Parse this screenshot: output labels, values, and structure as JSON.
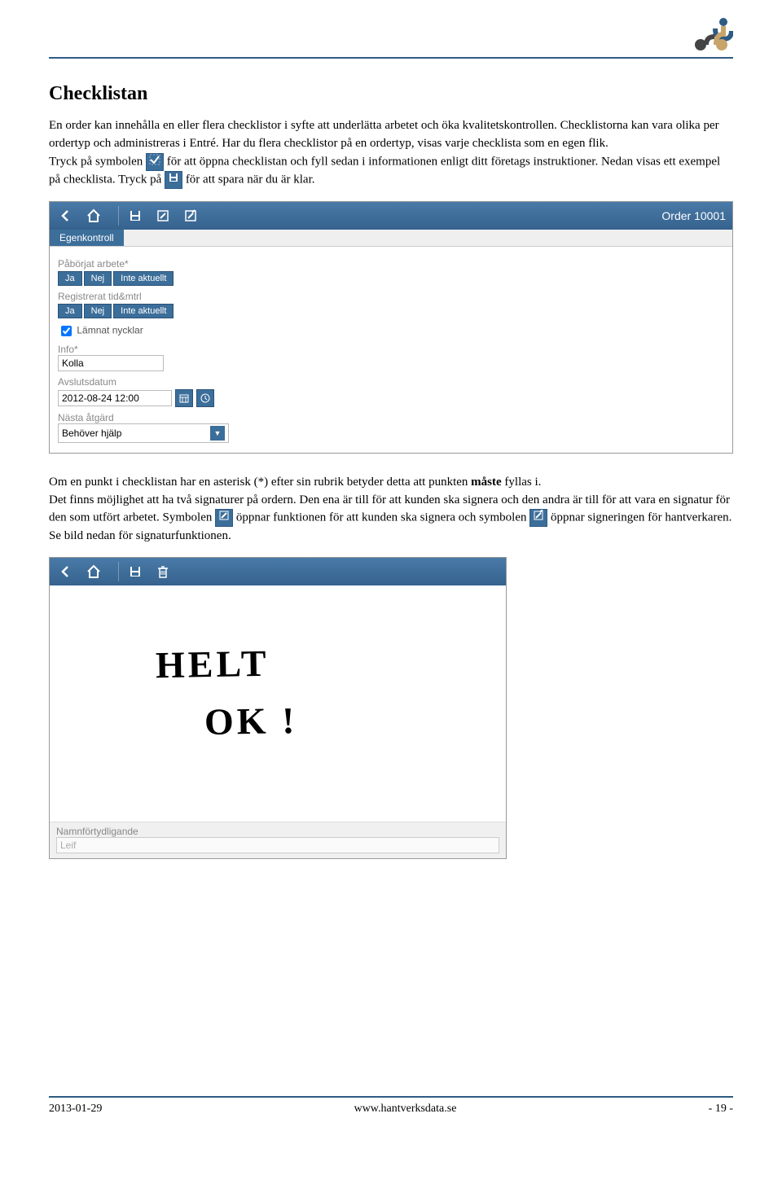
{
  "heading": "Checklistan",
  "para1_a": "En order kan innehålla en eller flera checklistor i syfte att underlätta arbetet och öka kvalitetskontrollen. Checklistorna kan vara olika per ordertyp och administreras i Entré. Har du flera checklistor på en ordertyp, visas varje checklista som en egen flik.",
  "para1_b": "Tryck på symbolen ",
  "para1_c": " för att öppna checklistan och fyll sedan i informationen enligt ditt företags instruktioner. Nedan visas ett exempel på checklista. Tryck på ",
  "para1_d": " för att spara när du är klar.",
  "screenshot1": {
    "order_label": "Order 10001",
    "tab": "Egenkontroll",
    "field1_label": "Påbörjat arbete*",
    "field2_label": "Registrerat tid&mtrl",
    "btn_yes": "Ja",
    "btn_no": "Nej",
    "btn_na": "Inte aktuellt",
    "check_label": "Lämnat nycklar",
    "info_label": "Info*",
    "info_value": "Kolla",
    "date_label": "Avslutsdatum",
    "date_value": "2012-08-24 12:00",
    "next_label": "Nästa åtgärd",
    "next_value": "Behöver hjälp"
  },
  "para2_a": "Om en punkt i checklistan har en asterisk (*) efter sin rubrik betyder detta att punkten ",
  "para2_b": "måste",
  "para2_c": " fyllas i.",
  "para3_a": "Det finns möjlighet att ha två signaturer på ordern. Den ena är till för att kunden ska signera och den andra är till för att vara en signatur för den som utfört arbetet. Symbolen ",
  "para3_b": " öppnar funktionen för att kunden ska signera och symbolen ",
  "para3_c": " öppnar signeringen för hantverkaren. Se bild nedan för signaturfunktionen.",
  "screenshot2": {
    "handwriting1": "HELT",
    "handwriting2": "OK !",
    "sig_label": "Namnförtydligande",
    "sig_value": "Leif"
  },
  "footer": {
    "date": "2013-01-29",
    "url": "www.hantverksdata.se",
    "page": "- 19 -"
  }
}
